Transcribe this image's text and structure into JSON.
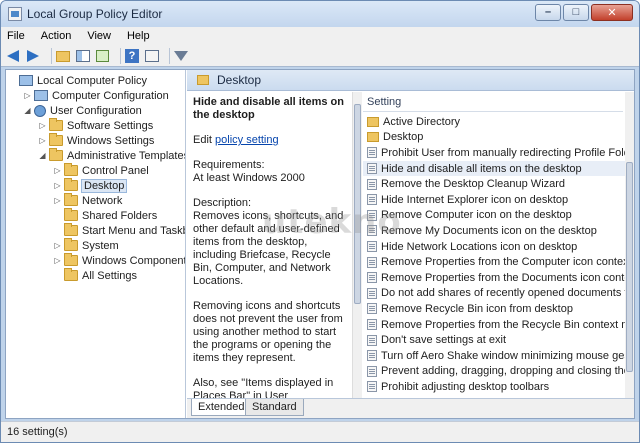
{
  "window": {
    "title": "Local Group Policy Editor"
  },
  "colors": {
    "accent": "#4e89c9",
    "folder": "#eec561",
    "link": "#0645ad"
  },
  "menu": [
    "File",
    "Action",
    "View",
    "Help"
  ],
  "toolbar_icons": [
    "back-icon",
    "forward-icon",
    "up-folder-icon",
    "show-hide-tree-icon",
    "export-list-icon",
    "help-icon",
    "properties-icon",
    "filter-icon"
  ],
  "tree": [
    {
      "label": "Local Computer Policy",
      "indent": 0,
      "icon": "computer",
      "exp": ""
    },
    {
      "label": "Computer Configuration",
      "indent": 1,
      "icon": "computer",
      "exp": "▷"
    },
    {
      "label": "User Configuration",
      "indent": 1,
      "icon": "user",
      "exp": "◢"
    },
    {
      "label": "Software Settings",
      "indent": 2,
      "icon": "folder",
      "exp": "▷"
    },
    {
      "label": "Windows Settings",
      "indent": 2,
      "icon": "folder",
      "exp": "▷"
    },
    {
      "label": "Administrative Templates",
      "indent": 2,
      "icon": "folder",
      "exp": "◢"
    },
    {
      "label": "Control Panel",
      "indent": 3,
      "icon": "folder",
      "exp": "▷"
    },
    {
      "label": "Desktop",
      "indent": 3,
      "icon": "folder",
      "exp": "▷",
      "selected": true
    },
    {
      "label": "Network",
      "indent": 3,
      "icon": "folder",
      "exp": "▷"
    },
    {
      "label": "Shared Folders",
      "indent": 3,
      "icon": "folder",
      "exp": ""
    },
    {
      "label": "Start Menu and Taskbar",
      "indent": 3,
      "icon": "folder",
      "exp": ""
    },
    {
      "label": "System",
      "indent": 3,
      "icon": "folder",
      "exp": "▷"
    },
    {
      "label": "Windows Components",
      "indent": 3,
      "icon": "folder",
      "exp": "▷"
    },
    {
      "label": "All Settings",
      "indent": 3,
      "icon": "folder",
      "exp": ""
    }
  ],
  "right_header": {
    "title": "Desktop"
  },
  "description": {
    "title": "Hide and disable all items on the desktop",
    "edit_prefix": "Edit ",
    "edit_link": "policy setting",
    "requirements_label": "Requirements:",
    "requirements_value": "At least Windows 2000",
    "description_label": "Description:",
    "description_text": "Removes icons, shortcuts, and other default and user-defined items from the desktop, including Briefcase, Recycle Bin, Computer, and Network Locations.",
    "para2": "Removing icons and shortcuts does not prevent the user from using another method to start the programs or opening the items they represent.",
    "para3": "Also, see \"Items displayed in Places Bar\" in User Configuration\\Administrative Templates\\Windows"
  },
  "list": {
    "header": "Setting",
    "rows": [
      {
        "label": "Active Directory",
        "type": "folder"
      },
      {
        "label": "Desktop",
        "type": "folder"
      },
      {
        "label": "Prohibit User from manually redirecting Profile Folders",
        "type": "setting"
      },
      {
        "label": "Hide and disable all items on the desktop",
        "type": "setting",
        "highlight": true
      },
      {
        "label": "Remove the Desktop Cleanup Wizard",
        "type": "setting"
      },
      {
        "label": "Hide Internet Explorer icon on desktop",
        "type": "setting"
      },
      {
        "label": "Remove Computer icon on the desktop",
        "type": "setting"
      },
      {
        "label": "Remove My Documents icon on the desktop",
        "type": "setting"
      },
      {
        "label": "Hide Network Locations icon on desktop",
        "type": "setting"
      },
      {
        "label": "Remove Properties from the Computer icon context menu",
        "type": "setting"
      },
      {
        "label": "Remove Properties from the Documents icon context menu",
        "type": "setting"
      },
      {
        "label": "Do not add shares of recently opened documents to Network Locations",
        "type": "setting"
      },
      {
        "label": "Remove Recycle Bin icon from desktop",
        "type": "setting"
      },
      {
        "label": "Remove Properties from the Recycle Bin context menu",
        "type": "setting"
      },
      {
        "label": "Don't save settings at exit",
        "type": "setting"
      },
      {
        "label": "Turn off Aero Shake window minimizing mouse gesture",
        "type": "setting"
      },
      {
        "label": "Prevent adding, dragging, dropping and closing the Taskbar's toolbars",
        "type": "setting"
      },
      {
        "label": "Prohibit adjusting desktop toolbars",
        "type": "setting"
      }
    ]
  },
  "tabs": [
    "Extended",
    "Standard"
  ],
  "status": {
    "text": "16 setting(s)"
  },
  "watermark": "utekno"
}
